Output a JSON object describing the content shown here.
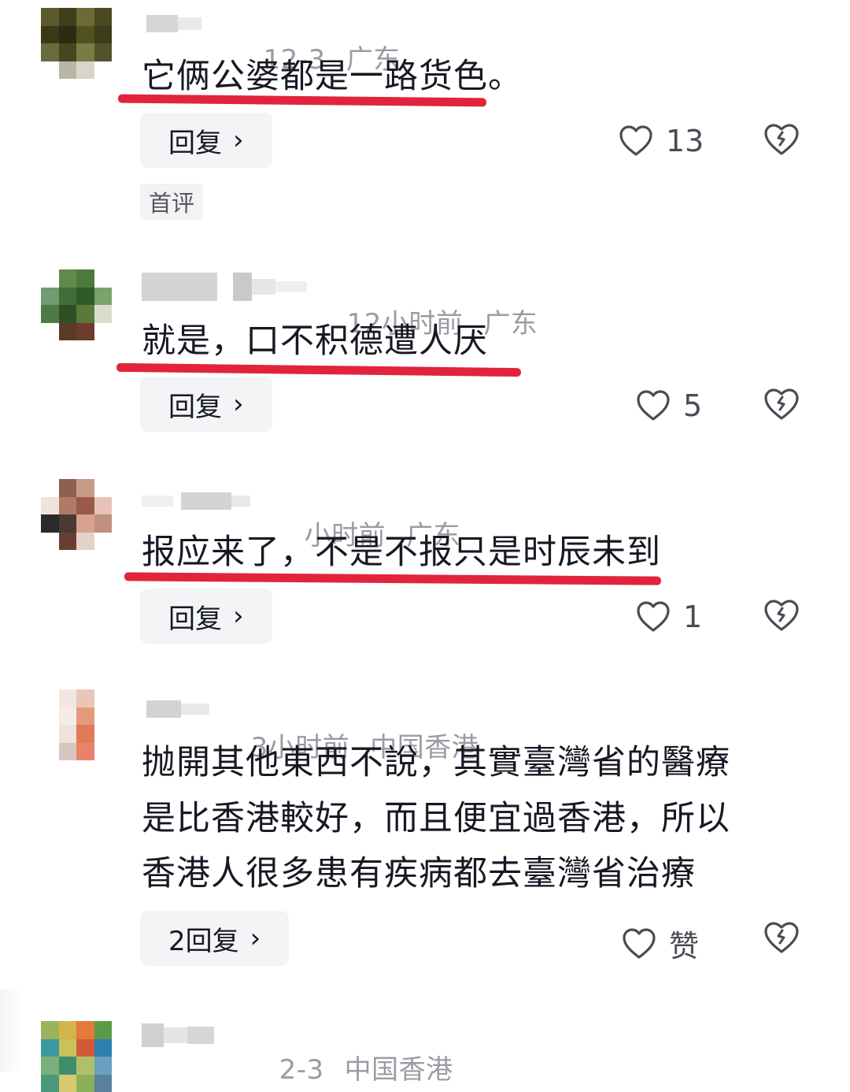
{
  "colors": {
    "highlight_underline": "#e2243a",
    "meta_text": "#9a9ca3",
    "body_text": "#161823",
    "reply_button_bg": "#f3f4f6"
  },
  "icons": {
    "like": "heart-outline-icon",
    "dislike": "broken-heart-icon",
    "chevron": "chevron-right-icon"
  },
  "comments": [
    {
      "time": "12-3",
      "region": "广东",
      "text": "它俩公婆都是一路货色。",
      "reply_label": "回复",
      "reply_chevron": "›",
      "likes": "13",
      "tag": "首评"
    },
    {
      "time": "12小时前",
      "region": "广东",
      "text": "就是，口不积德遭人厌",
      "reply_label": "回复",
      "reply_chevron": "›",
      "likes": "5"
    },
    {
      "time": "小时前",
      "region": "广东",
      "text": "报应来了，不是不报只是时辰未到",
      "reply_label": "回复",
      "reply_chevron": "›",
      "likes": "1"
    },
    {
      "time": "3小时前",
      "region": "中国香港",
      "text_lines": [
        "抛開其他東西不說，其實臺灣省的醫療",
        "是比香港較好，而且便宜過香港，所以",
        "香港人很多患有疾病都去臺灣省治療"
      ],
      "reply_label": "2回复",
      "reply_chevron": "›",
      "likes": "赞"
    },
    {
      "time": "2-3",
      "region": "中国香港"
    }
  ]
}
